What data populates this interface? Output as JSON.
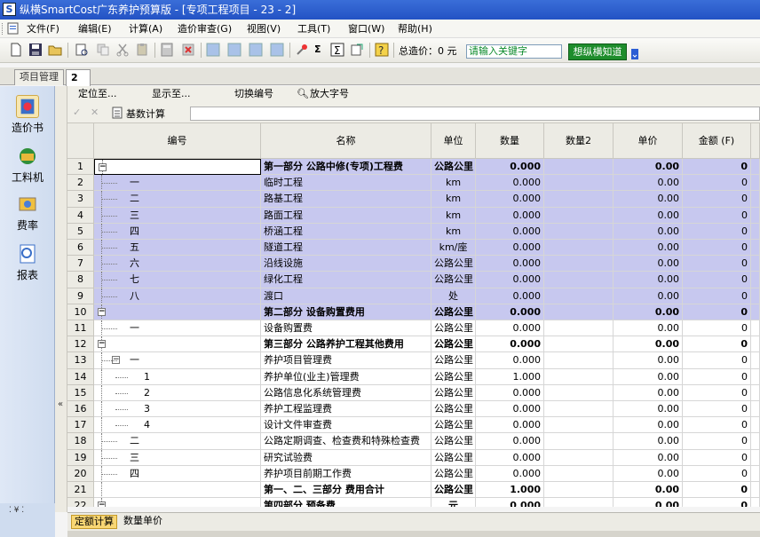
{
  "title": "纵横SmartCost广东养护预算版 - [专项工程项目 - 23 - 2]",
  "menu": [
    "文件(F)",
    "编辑(E)",
    "计算(A)",
    "造价审查(G)",
    "视图(V)",
    "工具(T)",
    "窗口(W)",
    "帮助(H)"
  ],
  "toolbar": {
    "total_label": "总造价：0 元",
    "search_placeholder": "请输入关键字",
    "kb_button": "想纵横知道",
    "sigma": "Σ"
  },
  "tabs": {
    "main": "项目管理",
    "active": "2"
  },
  "sidebar": [
    "造价书",
    "工料机",
    "费率",
    "报表"
  ],
  "subbar": [
    "定位至...",
    "显示至...",
    "切换编号",
    "放大字号"
  ],
  "formula_bar": {
    "base_calc": "基数计算"
  },
  "columns": [
    "编号",
    "名称",
    "单位",
    "数量",
    "数量2",
    "单价",
    "金额 (F)"
  ],
  "rows": [
    {
      "n": "1",
      "code": "",
      "name": "第一部分 公路中修(专项)工程费",
      "unit": "公路公里",
      "qty": "0.000",
      "price": "0.00",
      "amt": "0",
      "bold": true,
      "level": 0,
      "tog": true
    },
    {
      "n": "2",
      "code": "一",
      "name": "临时工程",
      "unit": "km",
      "qty": "0.000",
      "price": "0.00",
      "amt": "0",
      "level": 1
    },
    {
      "n": "3",
      "code": "二",
      "name": "路基工程",
      "unit": "km",
      "qty": "0.000",
      "price": "0.00",
      "amt": "0",
      "level": 1
    },
    {
      "n": "4",
      "code": "三",
      "name": "路面工程",
      "unit": "km",
      "qty": "0.000",
      "price": "0.00",
      "amt": "0",
      "level": 1
    },
    {
      "n": "5",
      "code": "四",
      "name": "桥涵工程",
      "unit": "km",
      "qty": "0.000",
      "price": "0.00",
      "amt": "0",
      "level": 1
    },
    {
      "n": "6",
      "code": "五",
      "name": "隧道工程",
      "unit": "km/座",
      "qty": "0.000",
      "price": "0.00",
      "amt": "0",
      "level": 1
    },
    {
      "n": "7",
      "code": "六",
      "name": "沿线设施",
      "unit": "公路公里",
      "qty": "0.000",
      "price": "0.00",
      "amt": "0",
      "level": 1
    },
    {
      "n": "8",
      "code": "七",
      "name": "绿化工程",
      "unit": "公路公里",
      "qty": "0.000",
      "price": "0.00",
      "amt": "0",
      "level": 1
    },
    {
      "n": "9",
      "code": "八",
      "name": "渡口",
      "unit": "处",
      "qty": "0.000",
      "price": "0.00",
      "amt": "0",
      "level": 1
    },
    {
      "n": "10",
      "code": "",
      "name": "第二部分 设备购置费用",
      "unit": "公路公里",
      "qty": "0.000",
      "price": "0.00",
      "amt": "0",
      "bold": true,
      "level": 0,
      "tog": true
    },
    {
      "n": "11",
      "code": "一",
      "name": "设备购置费",
      "unit": "公路公里",
      "qty": "0.000",
      "price": "0.00",
      "amt": "0",
      "level": 1
    },
    {
      "n": "12",
      "code": "",
      "name": "第三部分 公路养护工程其他费用",
      "unit": "公路公里",
      "qty": "0.000",
      "price": "0.00",
      "amt": "0",
      "bold": true,
      "level": 0,
      "tog": true
    },
    {
      "n": "13",
      "code": "一",
      "name": "养护项目管理费",
      "unit": "公路公里",
      "qty": "0.000",
      "price": "0.00",
      "amt": "0",
      "level": 1,
      "tog": true
    },
    {
      "n": "14",
      "code": "1",
      "name": "养护单位(业主)管理费",
      "unit": "公路公里",
      "qty": "1.000",
      "price": "0.00",
      "amt": "0",
      "level": 2
    },
    {
      "n": "15",
      "code": "2",
      "name": "公路信息化系统管理费",
      "unit": "公路公里",
      "qty": "0.000",
      "price": "0.00",
      "amt": "0",
      "level": 2
    },
    {
      "n": "16",
      "code": "3",
      "name": "养护工程监理费",
      "unit": "公路公里",
      "qty": "0.000",
      "price": "0.00",
      "amt": "0",
      "level": 2
    },
    {
      "n": "17",
      "code": "4",
      "name": "设计文件审查费",
      "unit": "公路公里",
      "qty": "0.000",
      "price": "0.00",
      "amt": "0",
      "level": 2
    },
    {
      "n": "18",
      "code": "二",
      "name": "公路定期调查、检查费和特殊检查费",
      "unit": "公路公里",
      "qty": "0.000",
      "price": "0.00",
      "amt": "0",
      "level": 1
    },
    {
      "n": "19",
      "code": "三",
      "name": "研究试验费",
      "unit": "公路公里",
      "qty": "0.000",
      "price": "0.00",
      "amt": "0",
      "level": 1
    },
    {
      "n": "20",
      "code": "四",
      "name": "养护项目前期工作费",
      "unit": "公路公里",
      "qty": "0.000",
      "price": "0.00",
      "amt": "0",
      "level": 1
    },
    {
      "n": "21",
      "code": "",
      "name": "第一、二、三部分 费用合计",
      "unit": "公路公里",
      "qty": "1.000",
      "price": "0.00",
      "amt": "0",
      "bold": true,
      "level": 0
    },
    {
      "n": "22",
      "code": "",
      "name": "第四部分 预备费",
      "unit": "元",
      "qty": "0.000",
      "price": "0.00",
      "amt": "0",
      "bold": true,
      "level": 0,
      "tog": true
    }
  ],
  "status_tabs": [
    "定额计算",
    "数量单价"
  ]
}
